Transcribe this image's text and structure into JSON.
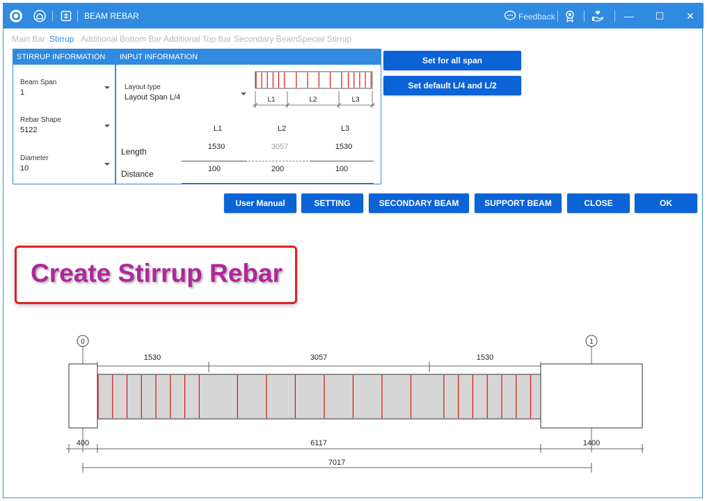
{
  "titlebar": {
    "title": "BEAM REBAR",
    "feedback_label": "Feedback"
  },
  "tabs": [
    {
      "label": "Main Bar",
      "active": false
    },
    {
      "label": "Stirrup",
      "active": true
    },
    {
      "label": "Additional Bottom Bar",
      "active": false
    },
    {
      "label": "Additional Top Bar",
      "active": false
    },
    {
      "label": "Secondary Beam",
      "active": false
    },
    {
      "label": "Special Stirrup",
      "active": false
    }
  ],
  "stirrup_info": {
    "header": "STIRRUP INFORMATION",
    "beam_span_label": "Beam Span",
    "beam_span_value": "1",
    "rebar_shape_label": "Rebar Shape",
    "rebar_shape_value": "5122",
    "diameter_label": "Diameter",
    "diameter_value": "10"
  },
  "input_info": {
    "header": "INPUT INFORMATION",
    "layout_type_label": "Layout type",
    "layout_type_value": "Layout Span L/4",
    "preview_labels": [
      "L1",
      "L2",
      "L3"
    ],
    "columns": [
      "L1",
      "L2",
      "L3"
    ],
    "length_label": "Length",
    "lengths": [
      "1530",
      "3057",
      "1530"
    ],
    "distance_label": "Distance",
    "distances": [
      "100",
      "200",
      "100"
    ]
  },
  "buttons": {
    "set_all_span": "Set for all span",
    "set_default": "Set default L/4 and L/2",
    "user_manual": "User Manual",
    "setting": "SETTING",
    "secondary_beam": "SECONDARY BEAM",
    "support_beam": "SUPPORT BEAM",
    "close": "CLOSE",
    "ok": "OK"
  },
  "callout": {
    "text": "Create Stirrup Rebar"
  },
  "drawing": {
    "axis_labels": [
      "0",
      "1"
    ],
    "top_dims": [
      "1530",
      "3057",
      "1530"
    ],
    "bottom_dims": [
      "400",
      "6117",
      "1400"
    ],
    "total_dim": "7017",
    "stirrup_segments": [
      {
        "length_mm": 1530,
        "spacing_mm": 100
      },
      {
        "length_mm": 3057,
        "spacing_mm": 200
      },
      {
        "length_mm": 1530,
        "spacing_mm": 100
      }
    ]
  },
  "colors": {
    "accent": "#2f8ae0",
    "button": "#0b63d6",
    "stirrup": "#e01010",
    "beam_fill": "#d6d6d6",
    "callout_text": "#b0279a",
    "callout_border": "#e02020"
  }
}
